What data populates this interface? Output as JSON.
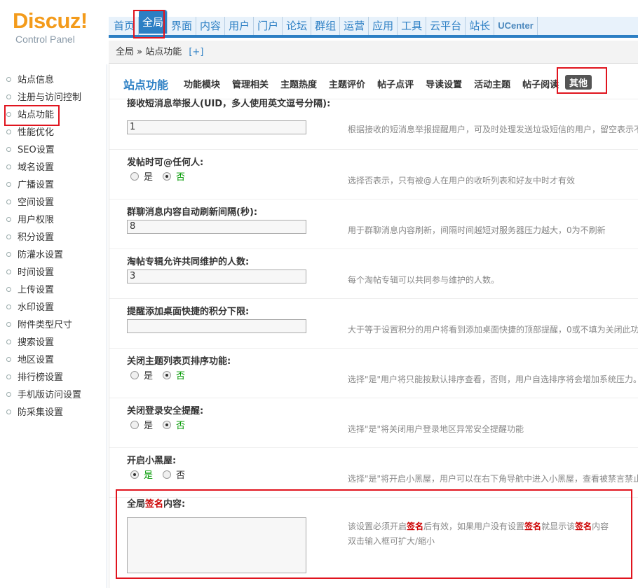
{
  "logo": {
    "main": "Discuz!",
    "sub": "Control Panel"
  },
  "topnav": {
    "items": [
      "首页",
      "全局",
      "界面",
      "内容",
      "用户",
      "门户",
      "论坛",
      "群组",
      "运营",
      "应用",
      "工具",
      "云平台",
      "站长",
      "UCenter"
    ],
    "active": "全局"
  },
  "breadcrumb": {
    "text": "全局 » 站点功能",
    "plus": "[+]"
  },
  "sidebar": {
    "items": [
      "站点信息",
      "注册与访问控制",
      "站点功能",
      "性能优化",
      "SEO设置",
      "域名设置",
      "广播设置",
      "空间设置",
      "用户权限",
      "积分设置",
      "防灌水设置",
      "时间设置",
      "上传设置",
      "水印设置",
      "附件类型尺寸",
      "搜索设置",
      "地区设置",
      "排行榜设置",
      "手机版访问设置",
      "防采集设置"
    ],
    "active": "站点功能"
  },
  "main": {
    "section_title": "站点功能",
    "tabs": [
      "功能模块",
      "管理相关",
      "主题热度",
      "主题评价",
      "帖子点评",
      "导读设置",
      "活动主题",
      "帖子阅读"
    ],
    "active_tab": "其他"
  },
  "settings": [
    {
      "label": "接收短消息举报人(UID，多人使用英文逗号分隔):",
      "value": "1",
      "desc": "根据接收的短消息举报提醒用户，可及时处理发送垃圾短信的用户，留空表示不"
    },
    {
      "label": "发帖时可@任何人:",
      "yes": "是",
      "no": "否",
      "selected": "no",
      "desc": "选择否表示，只有被@人在用户的收听列表和好友中时才有效"
    },
    {
      "label": "群聊消息内容自动刷新间隔(秒):",
      "value": "8",
      "desc": "用于群聊消息内容刷新，间隔时间越短对服务器压力越大，0为不刷新"
    },
    {
      "label": "淘帖专辑允许共同维护的人数:",
      "value": "3",
      "desc": "每个淘帖专辑可以共同参与维护的人数。"
    },
    {
      "label": "提醒添加桌面快捷的积分下限:",
      "value": "",
      "desc": "大于等于设置积分的用户将看到添加桌面快捷的顶部提醒，0或不填为关闭此功"
    },
    {
      "label": "关闭主题列表页排序功能:",
      "yes": "是",
      "no": "否",
      "selected": "no",
      "desc": "选择\"是\"用户将只能按默认排序查看，否则，用户自选排序将会增加系统压力。"
    },
    {
      "label": "关闭登录安全提醒:",
      "yes": "是",
      "no": "否",
      "selected": "no",
      "desc": "选择\"是\"将关闭用户登录地区异常安全提醒功能"
    },
    {
      "label": "开启小黑屋:",
      "yes": "是",
      "no": "否",
      "selected": "yes",
      "desc": "选择\"是\"将开启小黑屋，用户可以在右下角导航中进入小黑屋，查看被禁言禁止"
    }
  ],
  "signature": {
    "label_pre": "全局",
    "label_em": "签名",
    "label_post": "内容:",
    "desc1_a": "该设置必须开启",
    "desc1_em1": "签名",
    "desc1_b": "后有效，如果用户没有设置",
    "desc1_em2": "签名",
    "desc1_c": "就显示该",
    "desc1_em3": "签名",
    "desc1_d": "内容",
    "desc2": "双击输入框可扩大/缩小"
  }
}
